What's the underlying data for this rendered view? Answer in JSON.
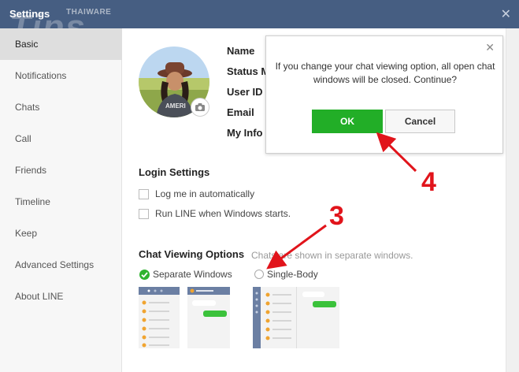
{
  "window": {
    "title": "Settings",
    "close_glyph": "✕"
  },
  "watermark": {
    "brand": "THAIWARE",
    "word": "Tips"
  },
  "sidebar": {
    "items": [
      {
        "label": "Basic",
        "active": true
      },
      {
        "label": "Notifications"
      },
      {
        "label": "Chats"
      },
      {
        "label": "Call"
      },
      {
        "label": "Friends"
      },
      {
        "label": "Timeline"
      },
      {
        "label": "Keep"
      },
      {
        "label": "Advanced Settings"
      },
      {
        "label": "About LINE"
      }
    ]
  },
  "profile": {
    "fields": [
      "Name",
      "Status M",
      "User ID",
      "Email",
      "My Info"
    ],
    "camera_icon": "camera-icon"
  },
  "login": {
    "title": "Login Settings",
    "auto_login": "Log me in automatically",
    "run_on_start": "Run LINE when Windows starts."
  },
  "chat_view": {
    "title": "Chat Viewing Options",
    "hint": "Chats are shown in separate windows.",
    "separate": "Separate Windows",
    "single": "Single-Body",
    "selected": "Separate Windows"
  },
  "dialog": {
    "message": "If you change your chat viewing option, all open chat windows will be closed. Continue?",
    "ok": "OK",
    "cancel": "Cancel",
    "close_glyph": "✕"
  },
  "annotations": {
    "step3": "3",
    "step4": "4"
  },
  "colors": {
    "titlebar": "#465e82",
    "ok_green": "#22ae27",
    "annotation_red": "#e1141b",
    "check_green": "#2fb32f"
  }
}
